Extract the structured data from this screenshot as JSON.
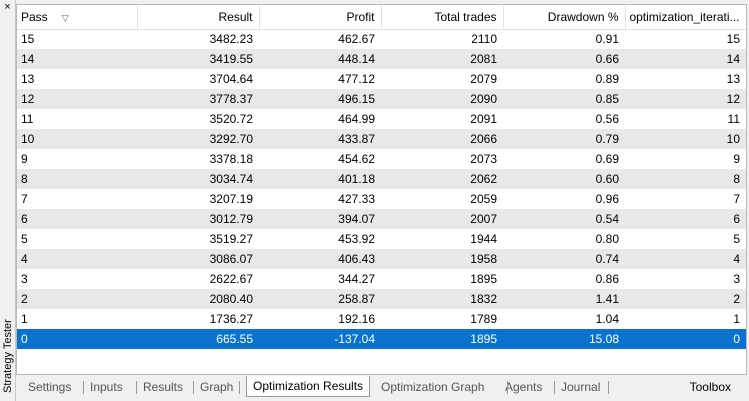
{
  "window": {
    "vertical_title": "Strategy Tester",
    "close_glyph": "×"
  },
  "table": {
    "columns": [
      "Pass",
      "Result",
      "Profit",
      "Total trades",
      "Drawdown %",
      "optimization_iterati..."
    ],
    "sort_indicator": "▽",
    "rows": [
      [
        "15",
        "3482.23",
        "462.67",
        "2110",
        "0.91",
        "15"
      ],
      [
        "14",
        "3419.55",
        "448.14",
        "2081",
        "0.66",
        "14"
      ],
      [
        "13",
        "3704.64",
        "477.12",
        "2079",
        "0.89",
        "13"
      ],
      [
        "12",
        "3778.37",
        "496.15",
        "2090",
        "0.85",
        "12"
      ],
      [
        "11",
        "3520.72",
        "464.99",
        "2091",
        "0.56",
        "11"
      ],
      [
        "10",
        "3292.70",
        "433.87",
        "2066",
        "0.79",
        "10"
      ],
      [
        "9",
        "3378.18",
        "454.62",
        "2073",
        "0.69",
        "9"
      ],
      [
        "8",
        "3034.74",
        "401.18",
        "2062",
        "0.60",
        "8"
      ],
      [
        "7",
        "3207.19",
        "427.33",
        "2059",
        "0.96",
        "7"
      ],
      [
        "6",
        "3012.79",
        "394.07",
        "2007",
        "0.54",
        "6"
      ],
      [
        "5",
        "3519.27",
        "453.92",
        "1944",
        "0.80",
        "5"
      ],
      [
        "4",
        "3086.07",
        "406.43",
        "1958",
        "0.74",
        "4"
      ],
      [
        "3",
        "2622.67",
        "344.27",
        "1895",
        "0.86",
        "3"
      ],
      [
        "2",
        "2080.40",
        "258.87",
        "1832",
        "1.41",
        "2"
      ],
      [
        "1",
        "1736.27",
        "192.16",
        "1789",
        "1.04",
        "1"
      ],
      [
        "0",
        "665.55",
        "-137.04",
        "1895",
        "15.08",
        "0"
      ]
    ],
    "selected_row": 15
  },
  "tabs": [
    "Settings",
    "Inputs",
    "Results",
    "Graph",
    "Optimization Results",
    "Optimization Graph",
    "Agents",
    "Journal"
  ],
  "active_tab": 4,
  "toolbox_label": "Toolbox",
  "colors": {
    "selection": "#0a73cf",
    "alt_row": "#e8e8e8"
  }
}
